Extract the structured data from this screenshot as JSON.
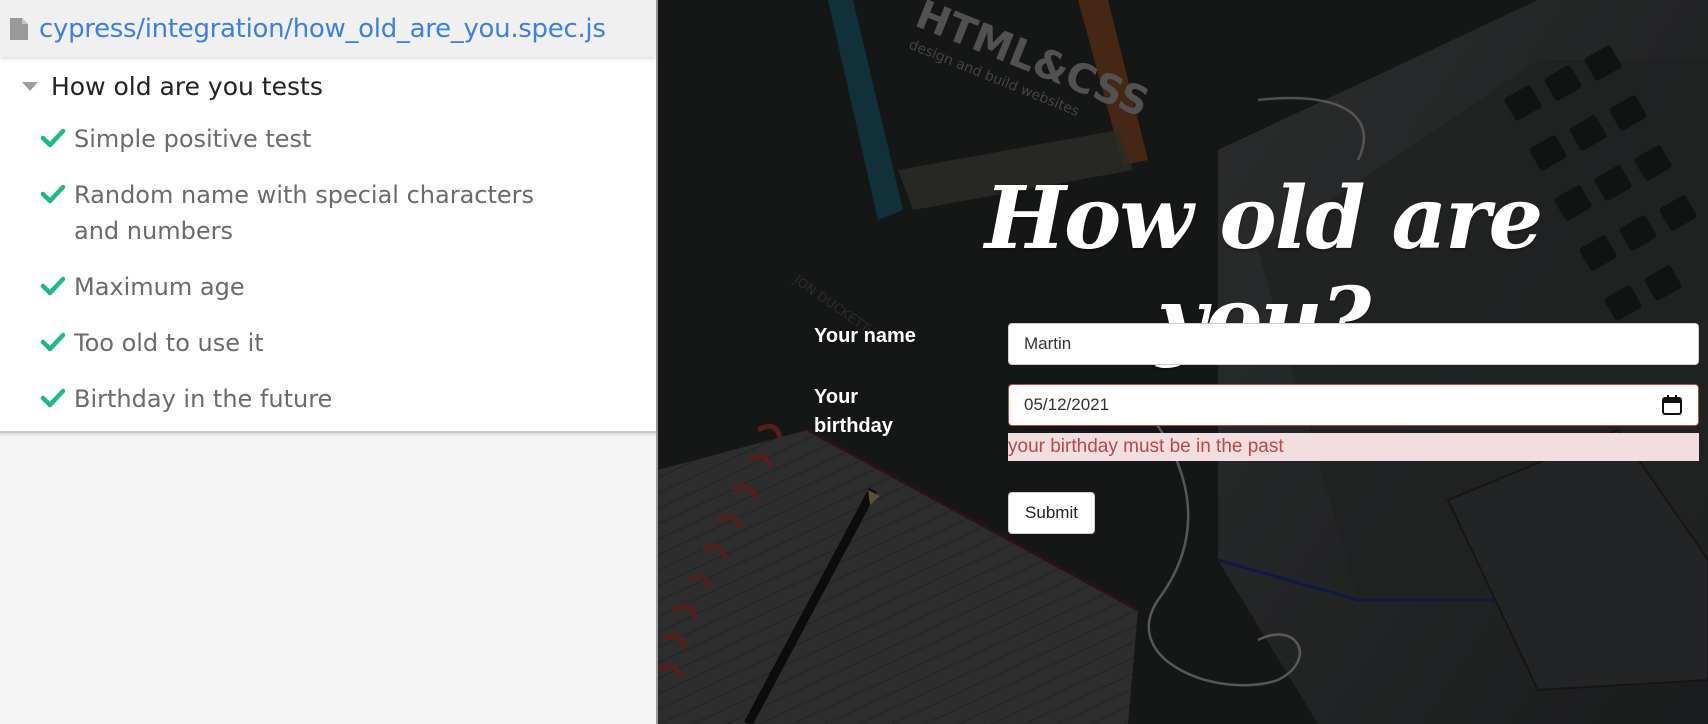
{
  "reporter": {
    "spec_path": "cypress/integration/how_old_are_you.spec.js",
    "suite_title": "How old are you tests",
    "tests": [
      {
        "title": "Simple positive test",
        "status": "passed"
      },
      {
        "title": "Random name with special characters and numbers",
        "status": "passed"
      },
      {
        "title": "Maximum age",
        "status": "passed"
      },
      {
        "title": "Too old to use it",
        "status": "passed"
      },
      {
        "title": "Birthday in the future",
        "status": "passed"
      }
    ],
    "colors": {
      "pass": "#1fb889",
      "link": "#3b82e0"
    }
  },
  "app": {
    "title": "How old are you?",
    "name_label": "Your name",
    "name_value": "Martin",
    "birthday_label": "Your birthday",
    "birthday_value": "05/12/2021",
    "error_message": "your birthday must be in the past",
    "submit_label": "Submit",
    "background_text": {
      "book_title": "HTML&CSS",
      "book_subtitle": "design and build websites",
      "book_author": "JON DUCKETT"
    },
    "colors": {
      "error_text": "#b94a48",
      "error_bg": "#f2dede"
    }
  }
}
